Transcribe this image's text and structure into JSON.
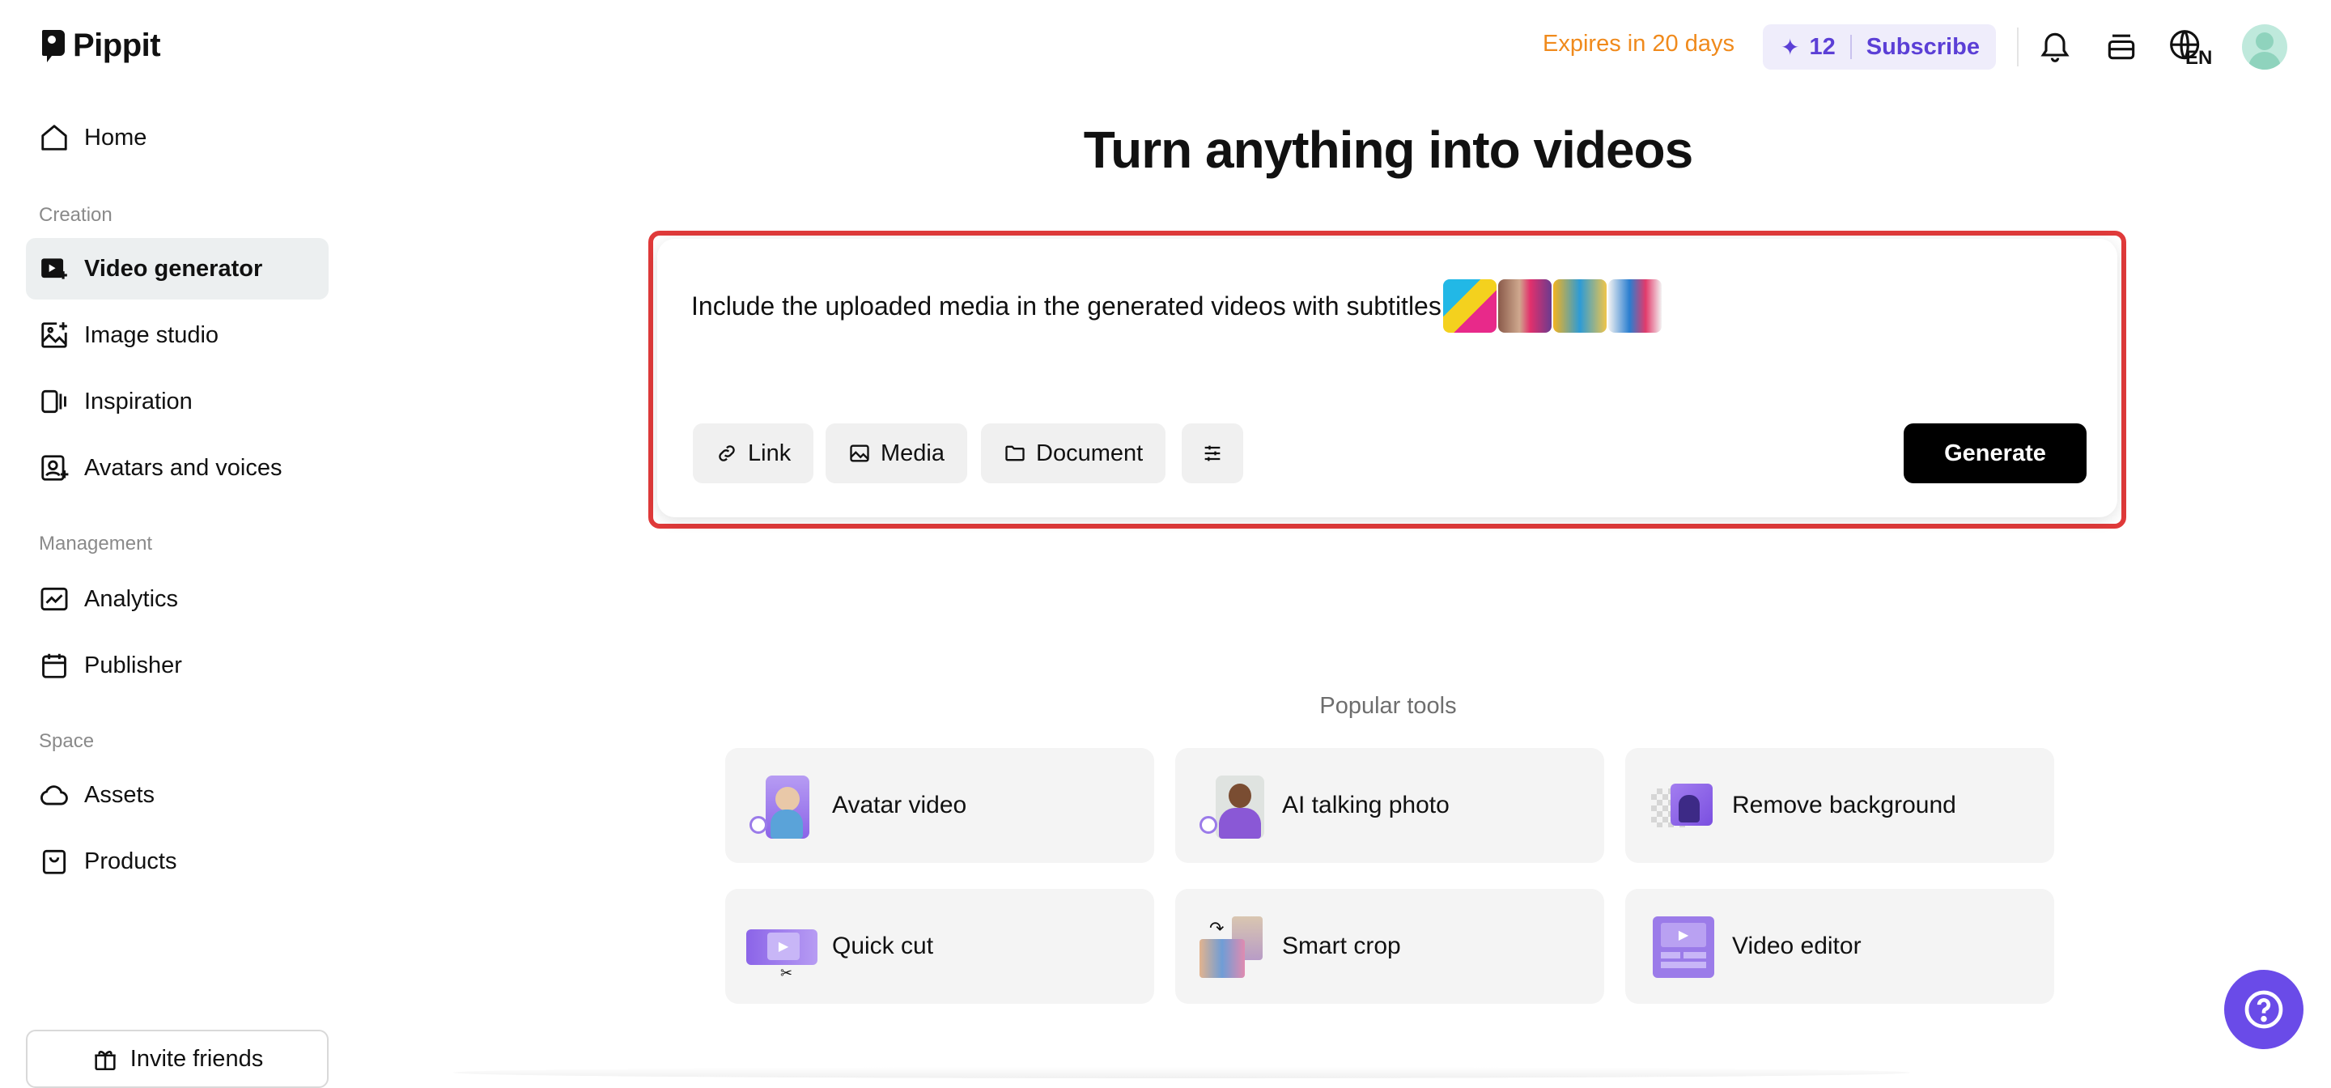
{
  "app": {
    "name": "Pippit"
  },
  "sidebar": {
    "home": "Home",
    "sections": {
      "creation": "Creation",
      "management": "Management",
      "space": "Space"
    },
    "creation_items": [
      {
        "label": "Video generator",
        "icon": "video-plus-icon",
        "active": true
      },
      {
        "label": "Image studio",
        "icon": "image-plus-icon"
      },
      {
        "label": "Inspiration",
        "icon": "inspiration-icon"
      },
      {
        "label": "Avatars and voices",
        "icon": "avatar-icon"
      }
    ],
    "management_items": [
      {
        "label": "Analytics",
        "icon": "analytics-icon"
      },
      {
        "label": "Publisher",
        "icon": "calendar-icon"
      }
    ],
    "space_items": [
      {
        "label": "Assets",
        "icon": "cloud-icon"
      },
      {
        "label": "Products",
        "icon": "bag-icon"
      }
    ],
    "invite": "Invite friends"
  },
  "header": {
    "expires": "Expires in 20 days",
    "credits": "12",
    "subscribe": "Subscribe",
    "language": "EN",
    "colors": {
      "expires": "#f08a1c",
      "accent": "#5b3fd6"
    }
  },
  "main": {
    "title": "Turn anything into videos",
    "prompt": {
      "text": "Include the uploaded media in the generated videos with subtitles",
      "buttons": {
        "link": "Link",
        "media": "Media",
        "document": "Document"
      },
      "generate": "Generate"
    },
    "popular_label": "Popular tools",
    "tools": [
      {
        "label": "Avatar video"
      },
      {
        "label": "AI talking photo"
      },
      {
        "label": "Remove background"
      },
      {
        "label": "Quick cut"
      },
      {
        "label": "Smart crop"
      },
      {
        "label": "Video editor"
      }
    ]
  }
}
